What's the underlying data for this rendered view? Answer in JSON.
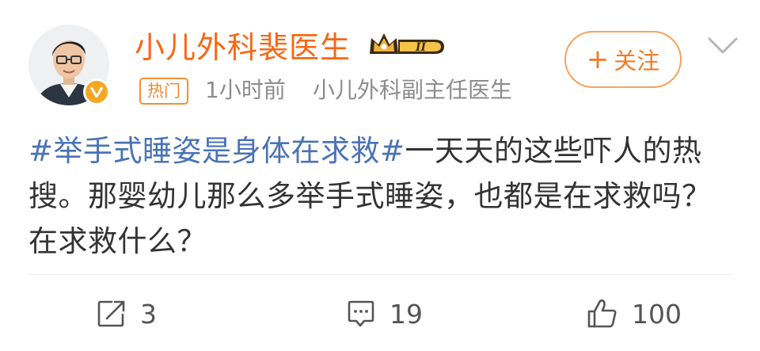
{
  "post": {
    "author": {
      "name": "小儿外科裴医生",
      "vip_level": "II",
      "verified": true
    },
    "hot_tag": "热门",
    "time": "1小时前",
    "source": "小儿外科副主任医生",
    "follow_label": "关注",
    "content": {
      "topic": "#举手式睡姿是身体在求救#",
      "text": "一天天的这些吓人的热搜。那婴幼儿那么多举手式睡姿，也都是在求救吗？ 在求救什么？"
    },
    "actions": {
      "repost_count": "3",
      "comment_count": "19",
      "like_count": "100"
    }
  },
  "colors": {
    "username": "#f86612",
    "topic_link": "#4a73b5",
    "follow_border": "#f7a35c",
    "verified_badge": "#f5a623",
    "meta_text": "#8c8c8c"
  },
  "icons": {
    "avatar": "doctor-portrait",
    "verified": "verified-v-badge-icon",
    "vip": "crown-vip-icon",
    "more": "chevron-down-icon",
    "repost": "share-icon",
    "comment": "comment-icon",
    "like": "thumbs-up-icon"
  }
}
